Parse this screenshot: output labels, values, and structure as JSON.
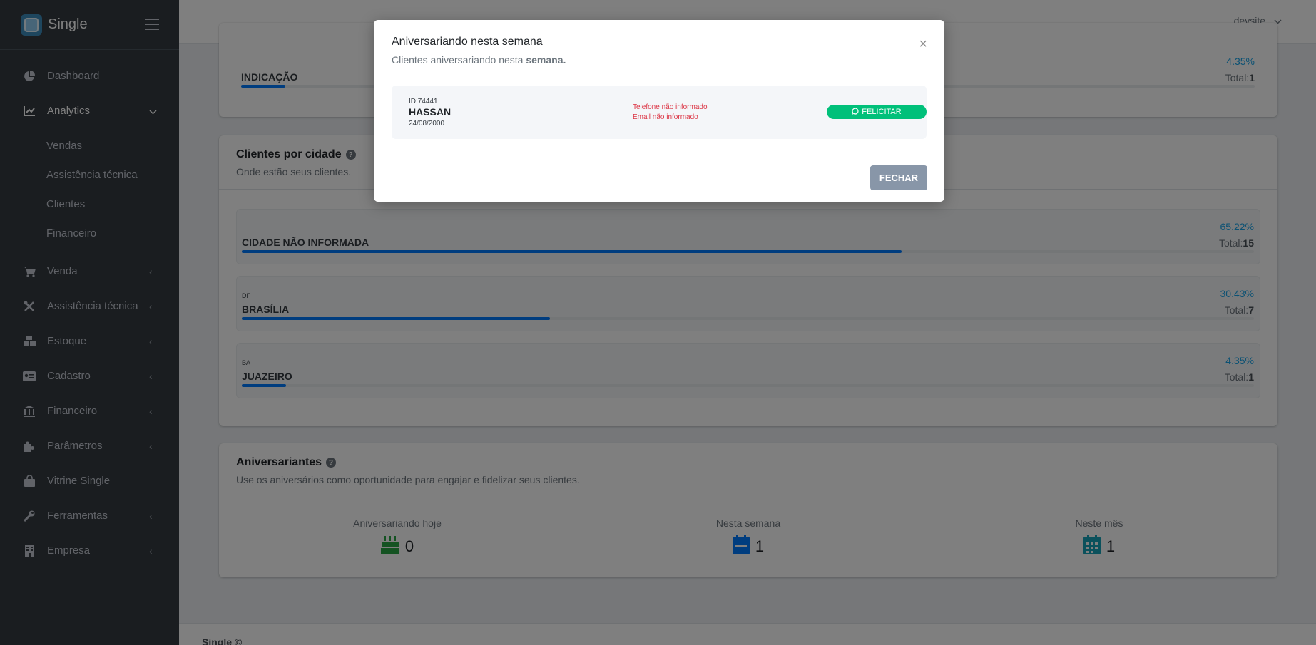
{
  "app": {
    "name": "Single"
  },
  "topbar": {
    "user": "devsite"
  },
  "sidebar": {
    "items": [
      {
        "label": "Dashboard",
        "icon": "pie-chart-icon"
      },
      {
        "label": "Analytics",
        "icon": "line-chart-icon",
        "active": true,
        "subitems": [
          "Vendas",
          "Assistência técnica",
          "Clientes",
          "Financeiro"
        ]
      },
      {
        "label": "Venda",
        "icon": "cart-icon"
      },
      {
        "label": "Assistência técnica",
        "icon": "tools-icon"
      },
      {
        "label": "Estoque",
        "icon": "boxes-icon"
      },
      {
        "label": "Cadastro",
        "icon": "id-card-icon"
      },
      {
        "label": "Financeiro",
        "icon": "bank-icon"
      },
      {
        "label": "Parâmetros",
        "icon": "puzzle-icon"
      },
      {
        "label": "Vitrine Single",
        "icon": "shopping-bag-icon"
      },
      {
        "label": "Ferramentas",
        "icon": "wrench-icon"
      },
      {
        "label": "Empresa",
        "icon": "building-icon"
      }
    ]
  },
  "top_partial": {
    "label": "INDICAÇÃO",
    "percent": "4.35%",
    "total_label": "Total:",
    "total": "1",
    "fraction": 0.0435
  },
  "cities_card": {
    "title": "Clientes por cidade",
    "subtitle": "Onde estão seus clientes.",
    "rows": [
      {
        "state": "",
        "label": "CIDADE NÃO INFORMADA",
        "percent": "65.22%",
        "total_label": "Total:",
        "total": "15",
        "fraction": 0.6522
      },
      {
        "state": "DF",
        "label": "BRASÍLIA",
        "percent": "30.43%",
        "total_label": "Total:",
        "total": "7",
        "fraction": 0.3043
      },
      {
        "state": "BA",
        "label": "JUAZEIRO",
        "percent": "4.35%",
        "total_label": "Total:",
        "total": "1",
        "fraction": 0.0435
      }
    ]
  },
  "birthdays_card": {
    "title": "Aniversariantes",
    "subtitle": "Use os aniversários como oportunidade para engajar e fidelizar seus clientes.",
    "stats": [
      {
        "label": "Aniversariando hoje",
        "value": "0",
        "icon": "birthday-cake-icon",
        "color": "#28a745"
      },
      {
        "label": "Nesta semana",
        "value": "1",
        "icon": "calendar-week-icon",
        "color": "#007bff"
      },
      {
        "label": "Neste mês",
        "value": "1",
        "icon": "calendar-month-icon",
        "color": "#17a2b8"
      }
    ]
  },
  "footer": {
    "text": "Single ©"
  },
  "modal": {
    "title": "Aniversariando nesta semana",
    "subtitle_prefix": "Clientes aniversariando nesta ",
    "subtitle_bold": "semana.",
    "client": {
      "id": "ID:74441",
      "name": "HASSAN",
      "date": "24/08/2000",
      "phone_warning": "Telefone não informado",
      "email_warning": "Email não informado"
    },
    "felicitar_label": "FELICITAR",
    "close_label": "FECHAR"
  },
  "colors": {
    "sidebar_bg": "#343a40",
    "progress": "#007bff",
    "whatsapp_green": "#00c07a",
    "warning_red": "#dc3545"
  }
}
